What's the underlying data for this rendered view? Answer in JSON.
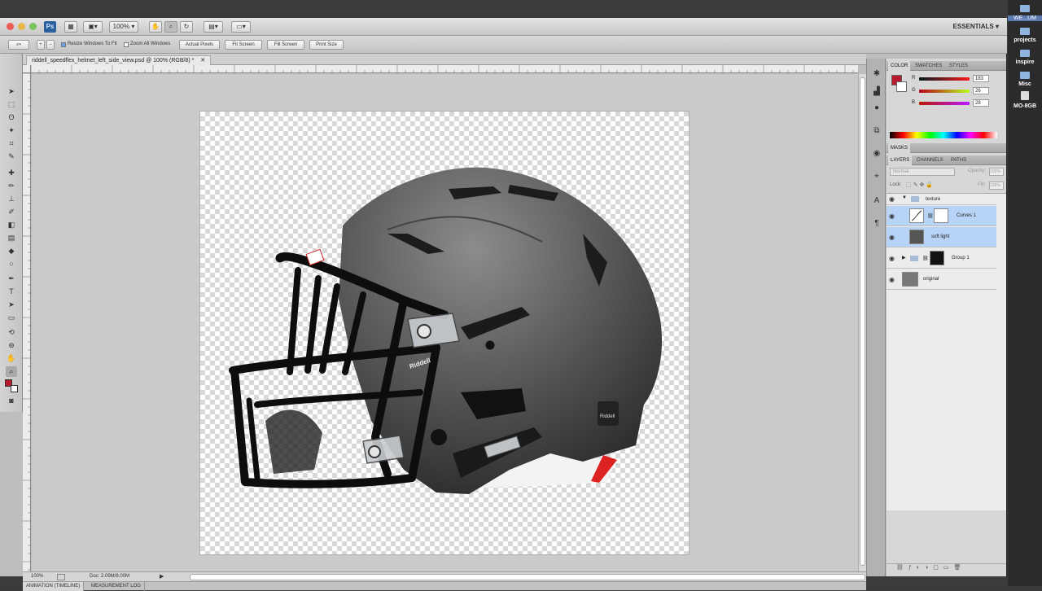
{
  "app": {
    "logo": "Ps",
    "zoom_select": "100%",
    "workspace": "ESSENTIALS ▾"
  },
  "options_bar": {
    "resize_windows": "Resize Windows To Fit",
    "zoom_all": "Zoom All Windows",
    "actual_pixels": "Actual Pixels",
    "fit_screen": "Fit Screen",
    "fill_screen": "Fill Screen",
    "print_size": "Print Size"
  },
  "document": {
    "tab_title": "riddell_speedflex_helmet_left_side_view.psd @ 100% (RGB/8) *",
    "zoom": "100%",
    "doc_size": "Doc: 2.09M/8.00M"
  },
  "bottom_tabs": [
    "ANIMATION (TIMELINE)",
    "MEASUREMENT LOG"
  ],
  "color_panel": {
    "tabs": [
      "COLOR",
      "SWATCHES",
      "STYLES"
    ],
    "channels": [
      {
        "label": "R",
        "value": "183"
      },
      {
        "label": "G",
        "value": "26"
      },
      {
        "label": "B",
        "value": "28"
      }
    ],
    "foreground": "#b71a2c"
  },
  "masks_panel": {
    "title": "MASKS"
  },
  "layers_panel": {
    "tabs": [
      "LAYERS",
      "CHANNELS",
      "PATHS"
    ],
    "blend_mode": "Normal",
    "opacity_label": "Opacity:",
    "opacity_value": "100%",
    "lock_label": "Lock:",
    "fill_label": "Fill:",
    "fill_value": "100%",
    "layers": [
      {
        "name": "texture",
        "type": "group"
      },
      {
        "name": "Curves 1",
        "type": "adjustment"
      },
      {
        "name": "soft light",
        "type": "pixel"
      },
      {
        "name": "Group 1",
        "type": "group"
      },
      {
        "name": "original",
        "type": "pixel"
      }
    ]
  },
  "helmet": {
    "brand": "Riddell",
    "side_label": "Riddell"
  },
  "side_menu": {
    "items": [
      "WE...UM",
      "projects",
      "inspire",
      "Misc",
      "MO-8GB"
    ]
  }
}
